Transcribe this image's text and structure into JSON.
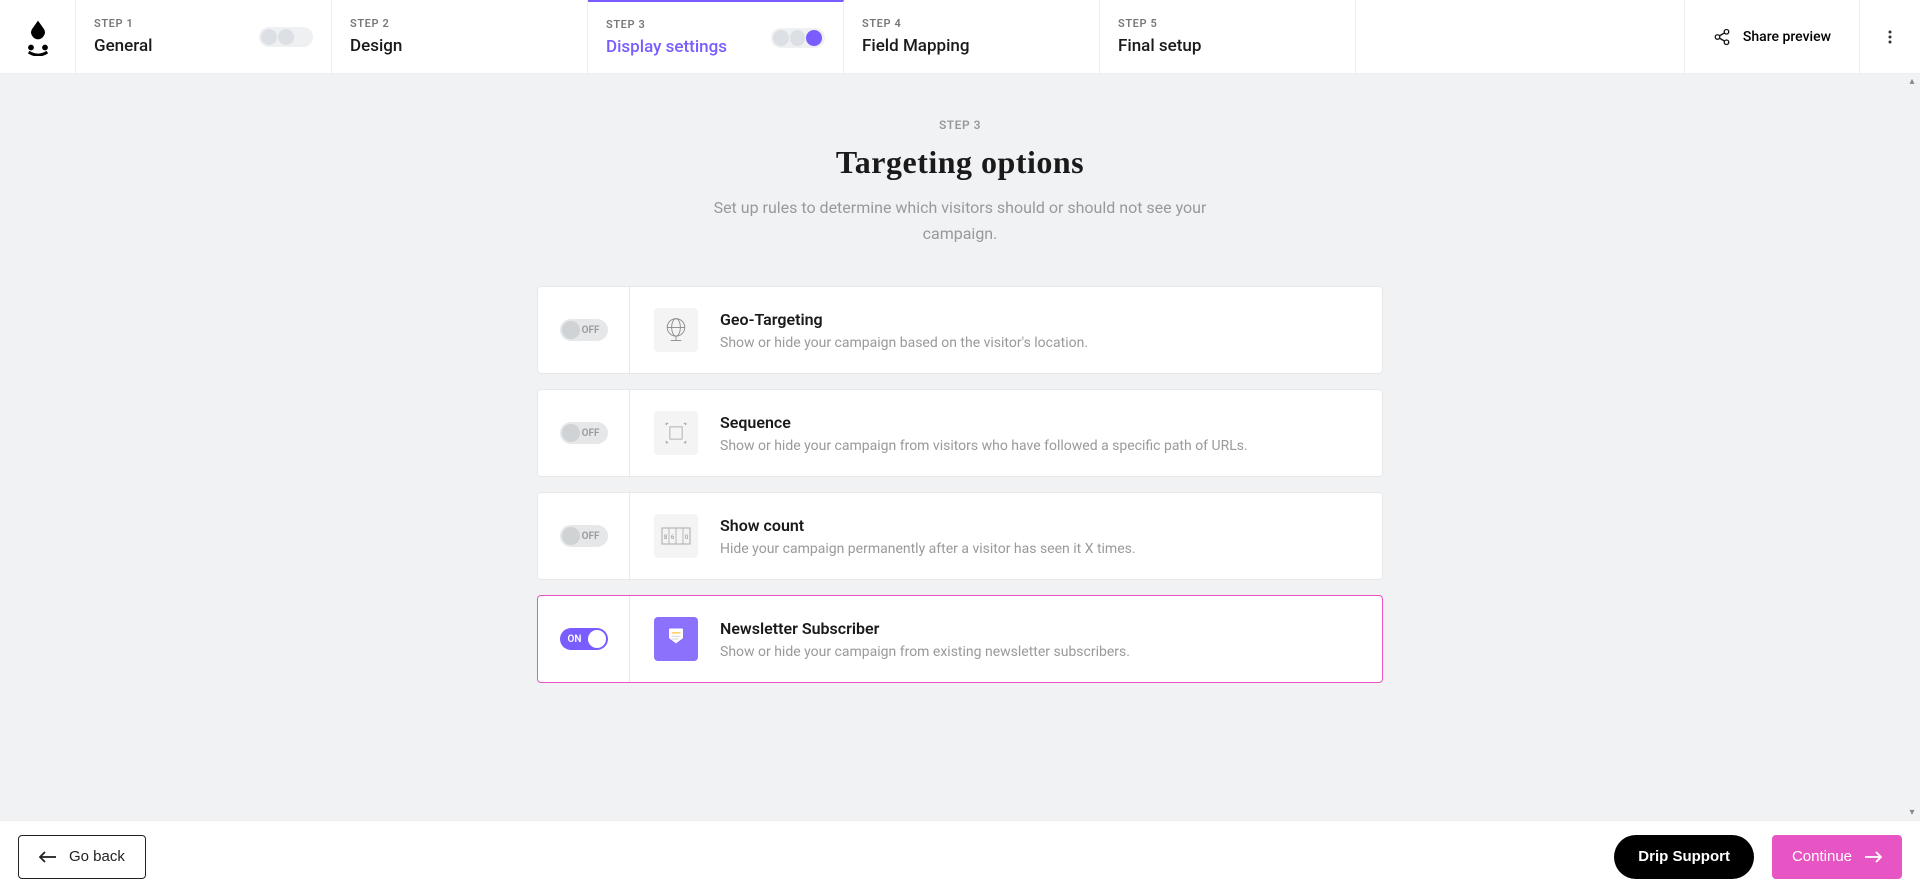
{
  "steps": [
    {
      "label": "STEP 1",
      "name": "General"
    },
    {
      "label": "STEP 2",
      "name": "Design"
    },
    {
      "label": "STEP 3",
      "name": "Display settings"
    },
    {
      "label": "STEP 4",
      "name": "Field Mapping"
    },
    {
      "label": "STEP 5",
      "name": "Final setup"
    }
  ],
  "share_preview": "Share preview",
  "page": {
    "step": "STEP 3",
    "title": "Targeting options",
    "subtitle": "Set up rules to determine which visitors should or should not see your campaign."
  },
  "toggle_labels": {
    "on": "ON",
    "off": "OFF"
  },
  "cards": [
    {
      "title": "Geo-Targeting",
      "desc": "Show or hide your campaign based on the visitor's location.",
      "on": false
    },
    {
      "title": "Sequence",
      "desc": "Show or hide your campaign from visitors who have followed a specific path of URLs.",
      "on": false
    },
    {
      "title": "Show count",
      "desc": "Hide your campaign permanently after a visitor has seen it X times.",
      "on": false
    },
    {
      "title": "Newsletter Subscriber",
      "desc": "Show or hide your campaign from existing newsletter subscribers.",
      "on": true
    }
  ],
  "footer": {
    "goback": "Go back",
    "support": "Drip Support",
    "continue": "Continue"
  }
}
